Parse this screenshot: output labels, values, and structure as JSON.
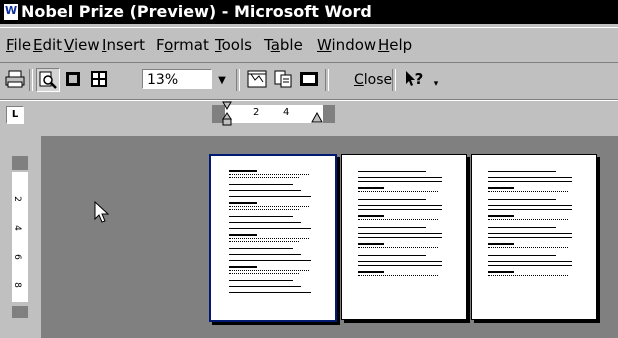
{
  "window": {
    "title": "Nobel Prize (Preview) - Microsoft Word"
  },
  "menu": {
    "items": [
      {
        "key": "file",
        "label": "File",
        "ul": "F",
        "rest": "ile"
      },
      {
        "key": "edit",
        "label": "Edit",
        "ul": "E",
        "rest": "dit"
      },
      {
        "key": "view",
        "label": "View",
        "ul": "V",
        "rest": "iew"
      },
      {
        "key": "insert",
        "label": "Insert",
        "ul": "I",
        "rest": "nsert"
      },
      {
        "key": "format",
        "label": "Format",
        "pre": "F",
        "ul": "o",
        "rest": "rmat"
      },
      {
        "key": "tools",
        "label": "Tools",
        "ul": "T",
        "rest": "ools"
      },
      {
        "key": "table",
        "label": "Table",
        "pre": "T",
        "ul": "a",
        "rest": "ble"
      },
      {
        "key": "window",
        "label": "Window",
        "ul": "W",
        "rest": "indow"
      },
      {
        "key": "help",
        "label": "Help",
        "ul": "H",
        "rest": "elp"
      }
    ]
  },
  "toolbar": {
    "zoom_value": "13%",
    "close_ul": "C",
    "close_rest": "lose",
    "help_label": "?"
  },
  "ruler": {
    "tab_label": "L",
    "h_numbers": [
      "2",
      "4"
    ],
    "v_numbers": [
      "2",
      "4",
      "6",
      "8"
    ]
  },
  "icons": {
    "app": "word-icon",
    "print": "printer-icon",
    "magnifier": "magnifier-icon",
    "one_page": "one-page-icon",
    "multiple_pages": "multiple-pages-icon",
    "view_ruler": "view-ruler-icon",
    "shrink_to_fit": "shrink-to-fit-icon",
    "full_screen": "full-screen-icon",
    "context_help": "context-help-icon",
    "more": "toolbar-options-icon"
  },
  "colors": {
    "titlebar": "#000000",
    "chrome": "#c0c0c0",
    "workspace": "#808080",
    "selected_page_border": "#001a73"
  },
  "preview": {
    "page_count": 3,
    "selected_page": 1
  }
}
